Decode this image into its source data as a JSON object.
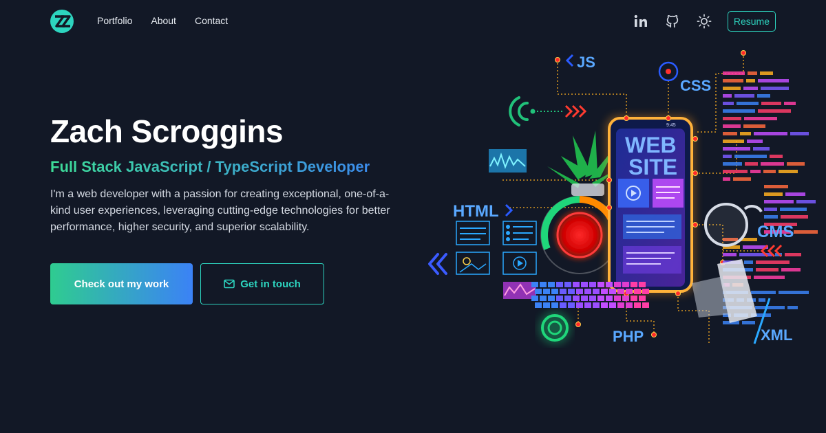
{
  "nav": {
    "links": [
      "Portfolio",
      "About",
      "Contact"
    ],
    "resume_label": "Resume",
    "icons": [
      "linkedin-icon",
      "github-icon",
      "sun-icon"
    ]
  },
  "hero": {
    "name": "Zach Scroggins",
    "role": "Full Stack JavaScript / TypeScript Developer",
    "description": "I'm a web developer with a passion for creating exceptional, one-of-a-kind user experiences, leveraging cutting-edge technologies for better performance, higher security, and superior scalability.",
    "primary_cta": "Check out my work",
    "secondary_cta": "Get in touch"
  },
  "illustration": {
    "labels": {
      "js": "JS",
      "css": "CSS",
      "html": "HTML",
      "cms": "CMS",
      "php": "PHP",
      "xml": "XML",
      "phone_line1": "WEB",
      "phone_line2": "SITE",
      "phone_time": "9:45"
    }
  },
  "colors": {
    "background": "#121826",
    "accent_teal": "#2dd4bf",
    "accent_green": "#3ddc97",
    "accent_blue": "#3b82f6"
  }
}
